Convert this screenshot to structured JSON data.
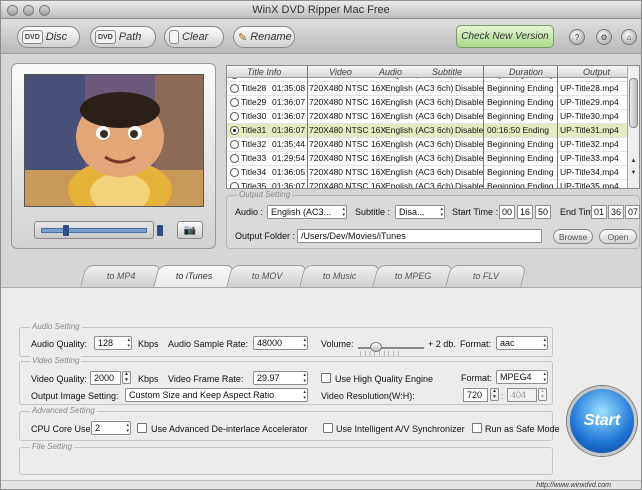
{
  "window": {
    "title": "WinX DVD Ripper Mac Free"
  },
  "toolbar": {
    "disc_label": "Disc",
    "path_label": "Path",
    "clear_label": "Clear",
    "rename_label": "Rename",
    "check_version_label": "Check New Version"
  },
  "titles": {
    "headers": {
      "title_info": "Title Info",
      "video": "Video",
      "audio": "Audio",
      "subtitle": "Subtitle",
      "duration": "Duration",
      "output": "Output"
    },
    "rows": [
      {
        "title": "Title27",
        "time": "01:36:07",
        "video": "720X480 NTSC 16X9",
        "audio": "English (AC3 6ch)",
        "subtitle": "Disabled",
        "duration": "Beginning Ending",
        "output": "UP-Title27.mp4",
        "selected": false
      },
      {
        "title": "Title28",
        "time": "01:35:08",
        "video": "720X480 NTSC 16X9",
        "audio": "English (AC3 6ch)",
        "subtitle": "Disabled",
        "duration": "Beginning Ending",
        "output": "UP-Title28.mp4",
        "selected": false
      },
      {
        "title": "Title29",
        "time": "01:36:07",
        "video": "720X480 NTSC 16X9",
        "audio": "English (AC3 6ch)",
        "subtitle": "Disabled",
        "duration": "Beginning Ending",
        "output": "UP-Title29.mp4",
        "selected": false
      },
      {
        "title": "Title30",
        "time": "01:36:07",
        "video": "720X480 NTSC 16X9",
        "audio": "English (AC3 6ch)",
        "subtitle": "Disabled",
        "duration": "Beginning Ending",
        "output": "UP-Title30.mp4",
        "selected": false
      },
      {
        "title": "Title31",
        "time": "01:36:07",
        "video": "720X480 NTSC 16X9",
        "audio": "English (AC3 6ch)",
        "subtitle": "Disabled",
        "duration": "00:16:50 Ending",
        "output": "UP-Title31.mp4",
        "selected": true
      },
      {
        "title": "Title32",
        "time": "01:35:44",
        "video": "720X480 NTSC 16X9",
        "audio": "English (AC3 6ch)",
        "subtitle": "Disabled",
        "duration": "Beginning Ending",
        "output": "UP-Title32.mp4",
        "selected": false
      },
      {
        "title": "Title33",
        "time": "01:29:54",
        "video": "720X480 NTSC 16X9",
        "audio": "English (AC3 6ch)",
        "subtitle": "Disabled",
        "duration": "Beginning Ending",
        "output": "UP-Title33.mp4",
        "selected": false
      },
      {
        "title": "Title34",
        "time": "01:36:05",
        "video": "720X480 NTSC 16X9",
        "audio": "English (AC3 6ch)",
        "subtitle": "Disabled",
        "duration": "Beginning Ending",
        "output": "UP-Title34.mp4",
        "selected": false
      },
      {
        "title": "Title35",
        "time": "01:36:07",
        "video": "720X480 NTSC 16X9",
        "audio": "English (AC3 6ch)",
        "subtitle": "Disabled",
        "duration": "Beginning Ending",
        "output": "UP-Title35.mp4",
        "selected": false
      }
    ]
  },
  "output_setting": {
    "legend": "Output Setting",
    "audio_label": "Audio :",
    "audio_value": "English (AC3...",
    "subtitle_label": "Subtitle :",
    "subtitle_value": "Disa...",
    "start_time_label": "Start Time :",
    "start_h": "00",
    "start_m": "16",
    "start_s": "50",
    "end_time_label": "End Time :",
    "end_h": "01",
    "end_m": "36",
    "end_s": "07",
    "folder_label": "Output Folder :",
    "folder_value": "/Users/Dev/Movies/iTunes",
    "browse_label": "Browse",
    "open_label": "Open"
  },
  "tabs": [
    "to MP4",
    "to iTunes",
    "to MOV",
    "to Music",
    "to MPEG",
    "to FLV"
  ],
  "audio_setting": {
    "legend": "Audio Setting",
    "quality_label": "Audio Quality:",
    "quality_value": "128",
    "kbps": "Kbps",
    "sample_rate_label": "Audio Sample Rate:",
    "sample_rate_value": "48000",
    "volume_label": "Volume:",
    "volume_value": "+ 2 db.",
    "format_label": "Format:",
    "format_value": "aac"
  },
  "video_setting": {
    "legend": "Video Setting",
    "quality_label": "Video Quality:",
    "quality_value": "2000",
    "kbps": "Kbps",
    "frame_rate_label": "Video Frame Rate:",
    "frame_rate_value": "29.97",
    "high_quality_label": "Use High Quality Engine",
    "format_label": "Format:",
    "format_value": "MPEG4",
    "image_setting_label": "Output Image Setting:",
    "image_setting_value": "Custom Size and Keep Aspect Ratio",
    "resolution_label": "Video Resolution(W:H):",
    "width": "720",
    "height": "404"
  },
  "advanced_setting": {
    "legend": "Advanced Setting",
    "cpu_label": "CPU Core Use:",
    "cpu_value": "2",
    "deinterlace_label": "Use Advanced De-interlace Accelerator",
    "av_sync_label": "Use Intelligent A/V Synchronizer",
    "safe_mode_label": "Run as Safe Mode"
  },
  "file_setting": {
    "legend": "File Setting"
  },
  "start_label": "Start",
  "footer": {
    "url": "http://www.winxdvd.com"
  }
}
